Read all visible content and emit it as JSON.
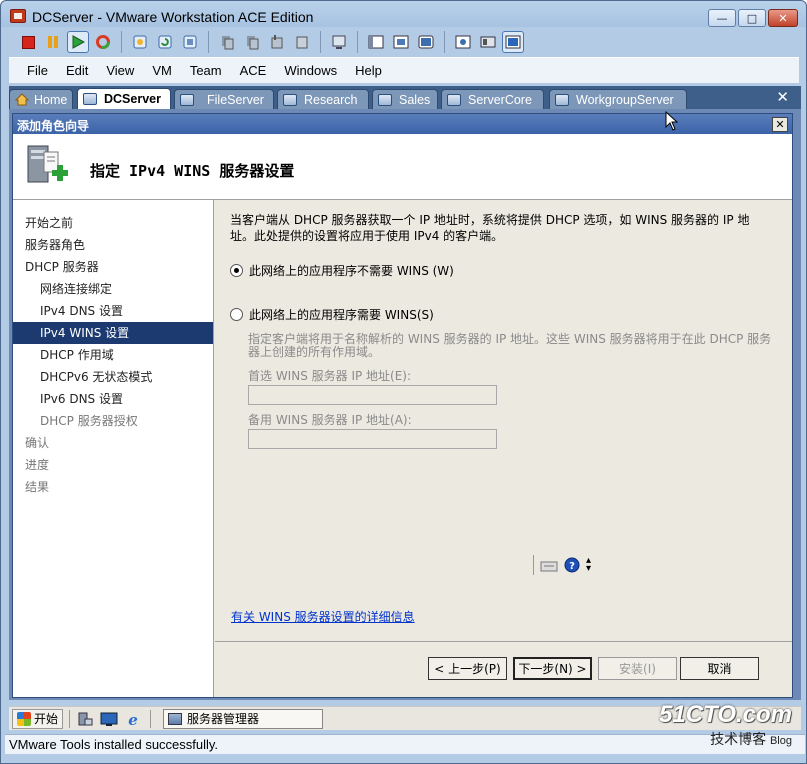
{
  "window": {
    "title": "DCServer - VMware Workstation ACE Edition"
  },
  "menu": [
    "File",
    "Edit",
    "View",
    "VM",
    "Team",
    "ACE",
    "Windows",
    "Help"
  ],
  "tabs": [
    {
      "label": "Home"
    },
    {
      "label": "DCServer"
    },
    {
      "label": "FileServer"
    },
    {
      "label": "Research"
    },
    {
      "label": "Sales"
    },
    {
      "label": "ServerCore"
    },
    {
      "label": "WorkgroupServer"
    }
  ],
  "wizard": {
    "title": "添加角色向导",
    "header": "指定 IPv4 WINS 服务器设置",
    "nav": [
      {
        "label": "开始之前"
      },
      {
        "label": "服务器角色"
      },
      {
        "label": "DHCP 服务器"
      },
      {
        "label": "网络连接绑定"
      },
      {
        "label": "IPv4 DNS 设置"
      },
      {
        "label": "IPv4 WINS 设置"
      },
      {
        "label": "DHCP 作用域"
      },
      {
        "label": "DHCPv6 无状态模式"
      },
      {
        "label": "IPv6 DNS 设置"
      },
      {
        "label": "DHCP 服务器授权"
      },
      {
        "label": "确认"
      },
      {
        "label": "进度"
      },
      {
        "label": "结果"
      }
    ],
    "description": "当客户端从 DHCP 服务器获取一个 IP 地址时，系统将提供 DHCP 选项，如 WINS 服务器的 IP 地址。此处提供的设置将应用于使用 IPv4 的客户端。",
    "option_no_wins": "此网络上的应用程序不需要 WINS (W)",
    "option_wins": "此网络上的应用程序需要 WINS(S)",
    "wins_desc": "指定客户端将用于名称解析的 WINS 服务器的 IP 地址。这些 WINS 服务器将用于在此 DHCP 服务器上创建的所有作用域。",
    "preferred_label": "首选 WINS 服务器 IP 地址(E):",
    "preferred_value": "",
    "alternate_label": "备用 WINS 服务器 IP 地址(A):",
    "alternate_value": "",
    "info_link": "有关 WINS 服务器设置的详细信息",
    "buttons": {
      "back": "< 上一步(P)",
      "next": "下一步(N) >",
      "install": "安装(I)",
      "cancel": "取消"
    }
  },
  "taskbar": {
    "start": "开始",
    "task": "服务器管理器"
  },
  "status": "VMware Tools installed successfully.",
  "watermark": {
    "site": "51CTO.com",
    "sub": "技术博客",
    "blog": "Blog"
  }
}
